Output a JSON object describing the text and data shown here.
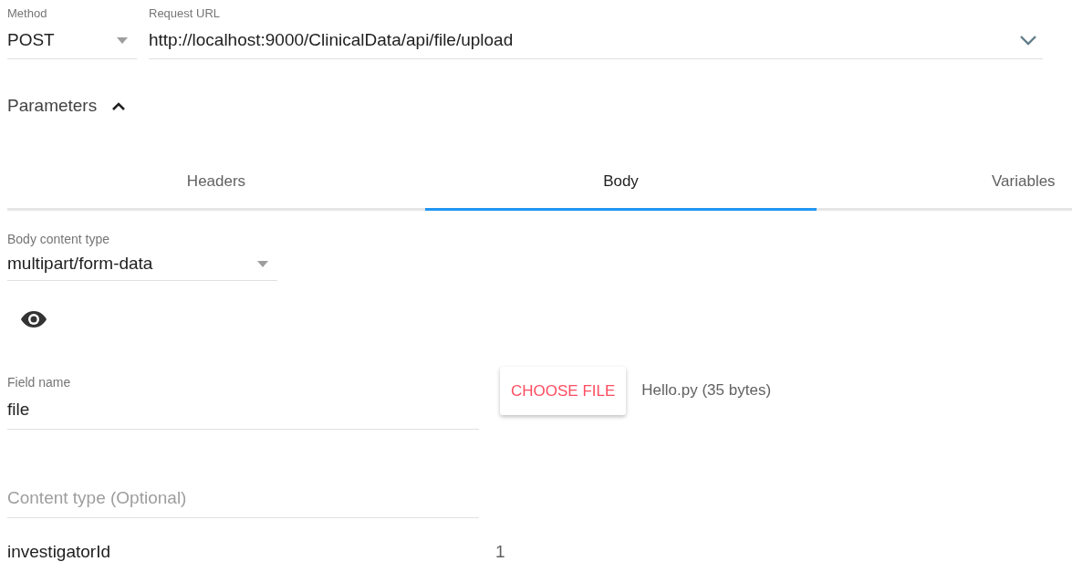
{
  "method": {
    "label": "Method",
    "value": "POST"
  },
  "request_url": {
    "label": "Request URL",
    "value": "http://localhost:9000/ClinicalData/api/file/upload"
  },
  "parameters": {
    "label": "Parameters",
    "expanded": true
  },
  "tabs": [
    {
      "label": "Headers",
      "selected": false
    },
    {
      "label": "Body",
      "selected": true
    },
    {
      "label": "Variables",
      "selected": false
    }
  ],
  "body_content_type": {
    "label": "Body content type",
    "value": "multipart/form-data"
  },
  "file_field": {
    "label": "Field name",
    "value": "file",
    "button": "CHOOSE FILE",
    "file_info": "Hello.py (35 bytes)",
    "content_type_placeholder": "Content type (Optional)"
  },
  "param_row": {
    "name": "investigatorId",
    "value": "1"
  }
}
